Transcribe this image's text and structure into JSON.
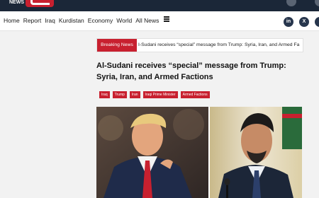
{
  "brand": {
    "wordmark": "NEWS"
  },
  "nav": {
    "items": [
      "Home",
      "Report",
      "Iraq",
      "Kurdistan",
      "Economy",
      "World",
      "All News"
    ],
    "menu_icon": "hamburger-menu-icon"
  },
  "social": {
    "linkedin": "in",
    "x": "X"
  },
  "ticker": {
    "label": "Breaking News",
    "text": "I-Sudani receives “special” message from Trump: Syria, Iran, and Armed Fa"
  },
  "article": {
    "title": "Al-Sudani receives “special” message from Trump: Syria, Iran, and Armed Factions",
    "tags": [
      "Iraq",
      "Trump",
      "Iran",
      "Iraqi Prime Minister",
      "Armed Factions"
    ]
  },
  "colors": {
    "accent": "#c8202f",
    "topbar": "#1b2738",
    "social": "#27364d"
  }
}
